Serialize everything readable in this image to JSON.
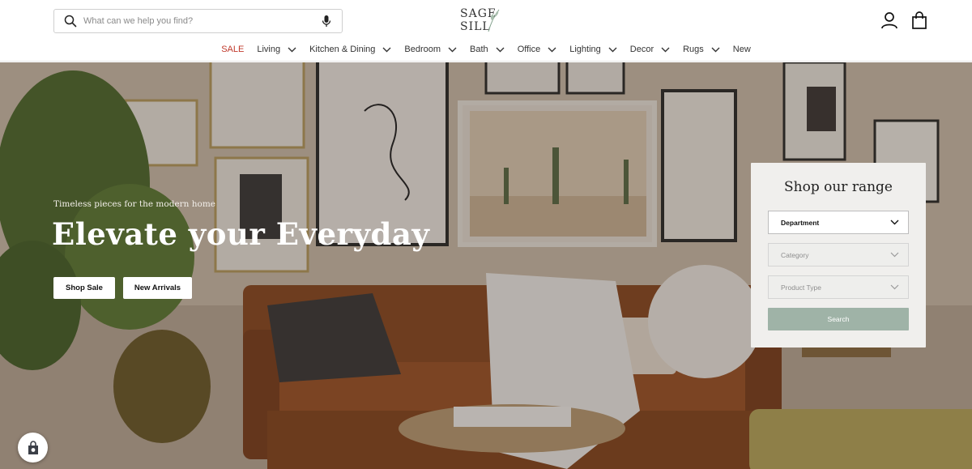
{
  "search": {
    "placeholder": "What can we help you find?"
  },
  "logo": {
    "text": "SAGE SILL"
  },
  "nav": {
    "items": [
      {
        "label": "SALE",
        "dropdown": false
      },
      {
        "label": "Living",
        "dropdown": true
      },
      {
        "label": "Kitchen & Dining",
        "dropdown": true
      },
      {
        "label": "Bedroom",
        "dropdown": true
      },
      {
        "label": "Bath",
        "dropdown": true
      },
      {
        "label": "Office",
        "dropdown": true
      },
      {
        "label": "Lighting",
        "dropdown": true
      },
      {
        "label": "Decor",
        "dropdown": true
      },
      {
        "label": "Rugs",
        "dropdown": true
      },
      {
        "label": "New",
        "dropdown": false
      }
    ]
  },
  "hero": {
    "tagline": "Timeless pieces for the modern home",
    "title": "Elevate your Everyday",
    "buttons": {
      "shop_sale": "Shop Sale",
      "new_arrivals": "New Arrivals"
    }
  },
  "shop_panel": {
    "title": "Shop our range",
    "department": "Department",
    "category": "Category",
    "product_type": "Product Type",
    "search_label": "Search"
  },
  "colors": {
    "sale": "#c0392b",
    "search_button": "#9fb3a7",
    "panel_bg": "#f0efed"
  },
  "icons": [
    "search-icon",
    "microphone-icon",
    "account-icon",
    "shopping-bag-icon",
    "chevron-down-icon",
    "rewards-icon"
  ]
}
